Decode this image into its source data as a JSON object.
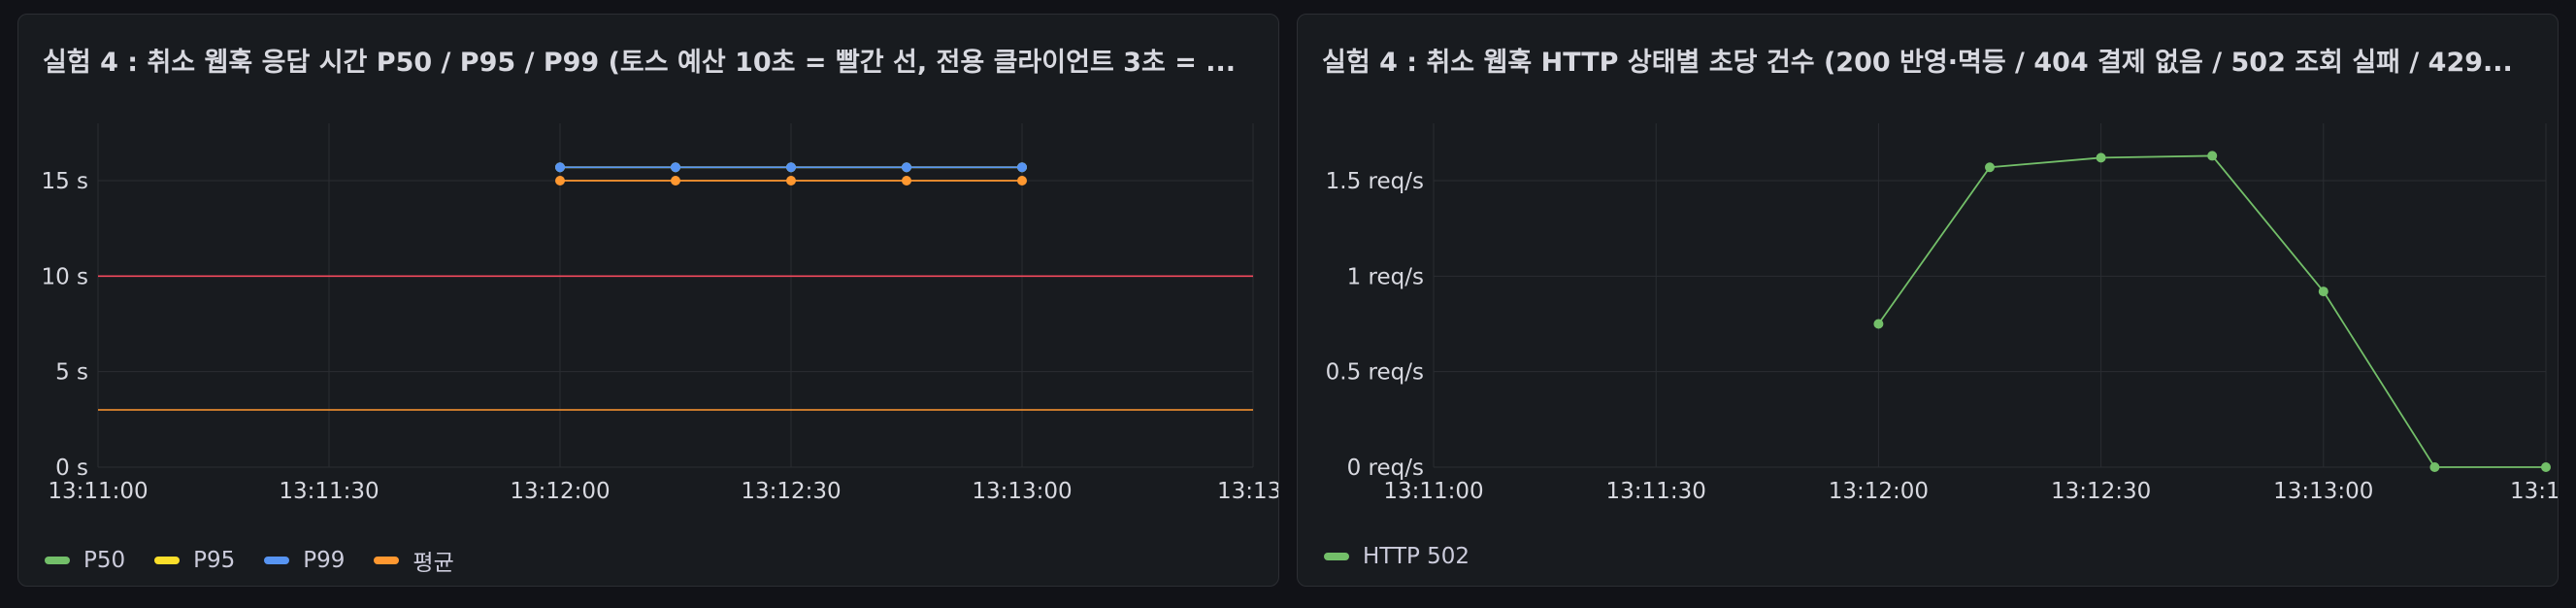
{
  "colors": {
    "green": "#73bf69",
    "yellow": "#fade2a",
    "blue": "#5794f2",
    "orange": "#ff9830",
    "red": "#f2495c",
    "threshold_orange": "#ff9830",
    "grid": "#2a2d32",
    "tick": "#d8d9e0"
  },
  "panels": [
    {
      "title": "실험 4 : 취소 웹훅 응답 시간 P50 / P95 / P99 (토스 예산 10초 = 빨간 선, 전용 클라이언트 3초 = ...",
      "legend": [
        {
          "label": "P50",
          "color": "#73bf69"
        },
        {
          "label": "P95",
          "color": "#fade2a"
        },
        {
          "label": "P99",
          "color": "#5794f2"
        },
        {
          "label": "평균",
          "color": "#ff9830"
        }
      ]
    },
    {
      "title": "실험 4 : 취소 웹훅 HTTP 상태별 초당 건수 (200 반영·멱등 / 404 결제 없음 / 502 조회 실패 / 429...",
      "legend": [
        {
          "label": "HTTP 502",
          "color": "#73bf69"
        }
      ]
    }
  ],
  "chart_data": [
    {
      "type": "line",
      "title": "실험 4 : 취소 웹훅 응답 시간 P50 / P95 / P99 (토스 예산 10초 = 빨간 선, 전용 클라이언트 3초 = ...",
      "x_ticks": [
        "13:11:00",
        "13:11:30",
        "13:12:00",
        "13:12:30",
        "13:13:00",
        "13:13:"
      ],
      "x": [
        "13:12:00",
        "13:12:15",
        "13:12:30",
        "13:12:45",
        "13:13:00"
      ],
      "xlim": [
        "13:11:00",
        "13:13:30"
      ],
      "y_ticks": [
        "0 s",
        "5 s",
        "10 s",
        "15 s"
      ],
      "y_tick_values": [
        0,
        5,
        10,
        15
      ],
      "ylim": [
        0,
        18
      ],
      "series": [
        {
          "name": "P50",
          "color": "#73bf69",
          "values": [
            15.7,
            15.7,
            15.7,
            15.7,
            15.7
          ]
        },
        {
          "name": "P95",
          "color": "#fade2a",
          "values": [
            15.7,
            15.7,
            15.7,
            15.7,
            15.7
          ]
        },
        {
          "name": "P99",
          "color": "#5794f2",
          "values": [
            15.7,
            15.7,
            15.7,
            15.7,
            15.7
          ]
        },
        {
          "name": "평균",
          "color": "#ff9830",
          "values": [
            15.0,
            15.0,
            15.0,
            15.0,
            15.0
          ]
        }
      ],
      "thresholds": [
        {
          "value": 10,
          "color": "#f2495c"
        },
        {
          "value": 3,
          "color": "#ff9830"
        }
      ],
      "grid": true,
      "legend_position": "bottom-left"
    },
    {
      "type": "line",
      "title": "실험 4 : 취소 웹훅 HTTP 상태별 초당 건수 (200 반영·멱등 / 404 결제 없음 / 502 조회 실패 / 429...",
      "x_ticks": [
        "13:11:00",
        "13:11:30",
        "13:12:00",
        "13:12:30",
        "13:13:00",
        "13:13:"
      ],
      "x": [
        "13:12:00",
        "13:12:15",
        "13:12:30",
        "13:12:45",
        "13:13:00",
        "13:13:15",
        "13:13:30"
      ],
      "xlim": [
        "13:11:00",
        "13:13:30"
      ],
      "y_ticks": [
        "0 req/s",
        "0.5 req/s",
        "1 req/s",
        "1.5 req/s"
      ],
      "y_tick_values": [
        0,
        0.5,
        1,
        1.5
      ],
      "ylim": [
        0,
        1.8
      ],
      "series": [
        {
          "name": "HTTP 502",
          "color": "#73bf69",
          "values": [
            0.75,
            1.57,
            1.62,
            1.63,
            0.92,
            0.0,
            0.0
          ]
        }
      ],
      "grid": true,
      "legend_position": "bottom-left"
    }
  ]
}
